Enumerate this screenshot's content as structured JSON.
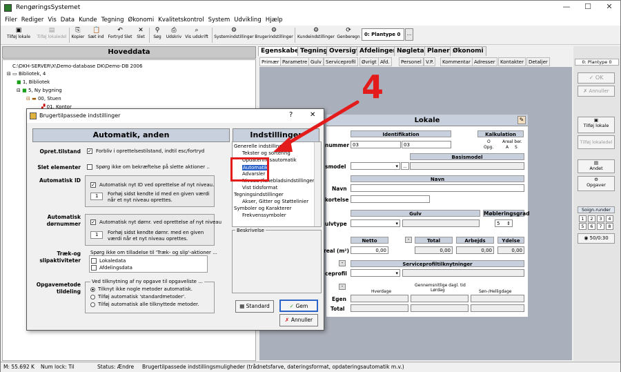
{
  "app": {
    "title": "RengøringsSystemet"
  },
  "menu": [
    "Filer",
    "Rediger",
    "Vis",
    "Data",
    "Kunde",
    "Tegning",
    "Økonomi",
    "Kvalitetskontrol",
    "System",
    "Udvikling",
    "Hjælp"
  ],
  "toolbar": {
    "items": [
      "Tilføj lokale",
      "Tilføj lokaledel",
      "Kopier",
      "Sæt ind",
      "Fortryd Slet",
      "Slet",
      "Søg",
      "Udskriv",
      "Vis udskrift",
      "Systemindstillinger",
      "Brugerindstillinger",
      "Kundeindstillinger",
      "Genberegn"
    ],
    "plantype": "0: Plantype 0",
    "dots": "..."
  },
  "left": {
    "header": "Hoveddata",
    "tree": [
      "C:\\DKH-SERVER\\X\\Demo-database DK\\Demo-DB 2006",
      "Bibliotek, 4",
      "1, Bibliotek",
      "5, Ny bygning",
      "00, Stuen",
      "01, Kontor"
    ]
  },
  "right": {
    "tabs": [
      "Egenskaber",
      "Tegning",
      "Oversigt",
      "Afdelinger",
      "Nøgletal",
      "Planer",
      "Økonomi"
    ],
    "subtabs": [
      "Primær",
      "Parametre",
      "Gulv",
      "Serviceprofil",
      "Øvrigt",
      "Afd.",
      "Personel",
      "V.P.",
      "Kommentar",
      "Adresser",
      "Kontakter",
      "Detaljer"
    ],
    "lokale": {
      "title": "Lokale",
      "identifikation": "Identifikation",
      "kalkulation": "Kalkulation",
      "kalk_cols": [
        "O",
        "Areal ber."
      ],
      "kalk_vals": [
        "Opg.",
        "A",
        "S"
      ],
      "id_value1": "03",
      "id_value2": "03",
      "basismodel": "Basismodel",
      "navn": "Navn",
      "gulv": "Gulv",
      "moblering": "Møbleringsgrad",
      "moblering_value": "5",
      "netto": "Netto",
      "total": "Total",
      "arbejds": "Arbejds",
      "ydelse": "Ydelse",
      "netto_value": "0,00",
      "total_value": "0,00",
      "arbejds_value": "0,00",
      "ydelse_value": "0,00",
      "serviceprofil": "Serviceprofiltilknytninger",
      "gennemsnit": "Gennemsnitlige dagl. tid",
      "hverdage": "Hverdage",
      "lordag": "Lørdag",
      "sondag": "Søn-/Helligdage",
      "row_labels": [
        "nummer",
        "smodel",
        "Navn",
        "kortelse",
        "ulvtype",
        "real (m²)",
        "ceprofil",
        "Egen",
        "Total"
      ]
    },
    "callout": "4"
  },
  "rightpanel": {
    "plantype": "0: Plantype 0",
    "ok": "OK",
    "annuller": "Annuller",
    "tilfoj_lokale": "Tilføj lokale",
    "tilfoj_lokaledel": "Tilføj lokaledel",
    "andet": "Andet",
    "opgaver": "Opgaver",
    "soign": "Soign.runder",
    "nums": [
      "1",
      "2",
      "3",
      "4",
      "5",
      "6",
      "7",
      "8"
    ],
    "time": "50/0:30"
  },
  "status": {
    "memory": "M: 55.692 K",
    "numlock": "Num lock: Til",
    "status": "Status: Ændre",
    "message": "Brugertilpassede indstillingsmuligheder (trådnetsfarve, dateringsformat, opdateringsautomatik m.v.)"
  },
  "dialog": {
    "title": "Brugertilpassede indstillinger",
    "help": "?",
    "close": "✕",
    "main_header": "Automatik, anden",
    "settings_header": "Indstillinger",
    "opret_label": "Opret.tilstand",
    "opret_text": "Forbliv i oprettelsestilstand, indtil esc/fortryd",
    "slet_label": "Slet elementer",
    "slet_text": "Spørg ikke om bekræftelse på slette aktioner ..",
    "autoid_label": "Automatisk ID",
    "autoid_text": "Automatisk nyt ID ved oprettelse af nyt niveau.",
    "autoid_spin": "1",
    "autoid_sub": "Forhøj sidst kendte id med en given værdi når et nyt niveau oprettes.",
    "autodor_label": "Automatisk dørnummer",
    "autodor_text": "Automatisk nyt dørnr. ved oprettelse af nyt niveau",
    "autodor_spin": "1",
    "autodor_sub": "Forhøj sidst kendte dørnr. med en given værdi når et nyt niveau oprettes.",
    "traek_label": "Træk-og slipaktiviteter",
    "traek_group": "Spørg ikke om tilladelse til 'Træk- og slip'-aktioner ...",
    "traek_items": [
      "Lokaledata",
      "Afdelingsdata"
    ],
    "opg_label": "Opgavemetode tildeling",
    "opg_group": "Ved tilknytning af ny opgave til opgaveliste ...",
    "opg_items": [
      "Tilknyt ikke nogle metoder automatisk.",
      "Tilføj automatisk 'standardmetoder'.",
      "Tilføj automatisk alle tilknyttede metoder."
    ],
    "tree_items": [
      "Generelle indstillinger",
      "Tekster og sortering",
      "Opdateringsautomatik",
      "Automatik",
      "Advarsler",
      "Niveau-/fanebladsindstillinger",
      "Vist tidsformat",
      "Tegningsindstillinger",
      "Akser, Gitter og Støttelinier",
      "Symboler og Karakterer",
      "Frekvenssymboler"
    ],
    "beskrivelse": "Beskrivelse",
    "standard": "Standard",
    "gem": "Gem",
    "annuller": "Annuller"
  }
}
